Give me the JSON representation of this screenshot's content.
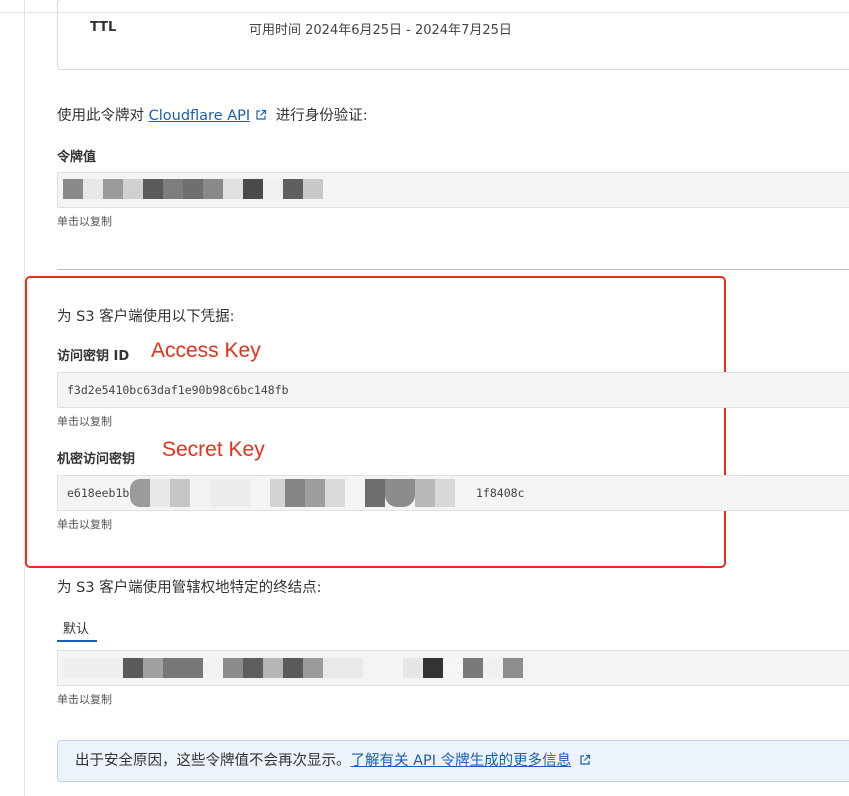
{
  "ttl": {
    "label": "TTL",
    "value": "可用时间 2024年6月25日 - 2024年7月25日"
  },
  "intro": {
    "before": "使用此令牌对",
    "link": "Cloudflare API",
    "after": "进行身份验证:"
  },
  "token": {
    "label": "令牌值",
    "hint": "单击以复制"
  },
  "s3": {
    "title": "为 S3 客户端使用以下凭据:",
    "access_key": {
      "label": "访问密钥 ID",
      "value": "f3d2e5410bc63daf1e90b98c6bc148fb",
      "hint": "单击以复制",
      "annotation": "Access Key"
    },
    "secret_key": {
      "label": "机密访问密钥",
      "prefix": "e618eeb1b",
      "suffix": "1f8408c",
      "hint": "单击以复制",
      "annotation": "Secret Key"
    }
  },
  "endpoint": {
    "title": "为 S3 客户端使用管辖权地特定的终结点:",
    "tab": "默认",
    "hint": "单击以复制"
  },
  "notice": {
    "text": "出于安全原因，这些令牌值不会再次显示。",
    "link": "了解有关 API 令牌生成的更多信息"
  },
  "colors": {
    "accent": "#1a5fb4",
    "annotation": "#e5301c",
    "notice_bg": "#edf3fb"
  }
}
